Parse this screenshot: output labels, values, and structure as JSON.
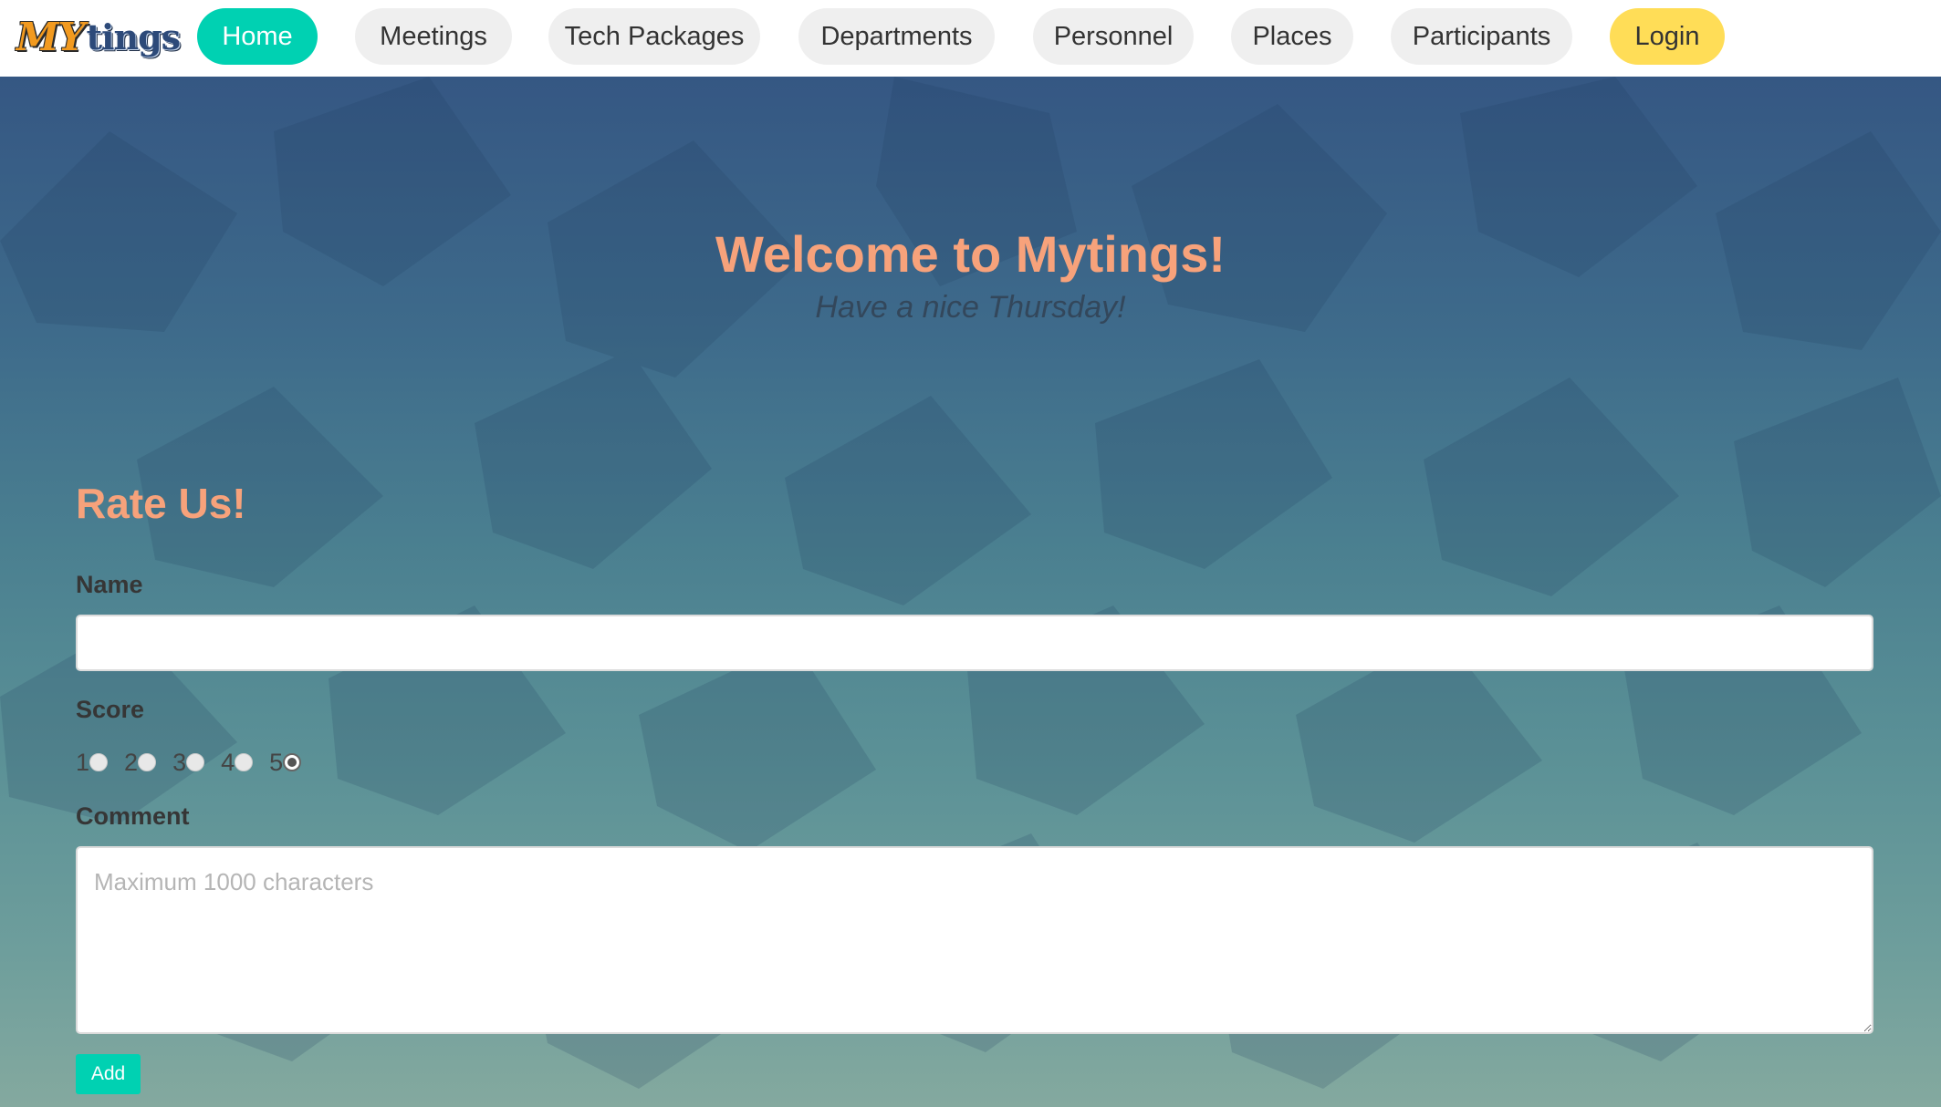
{
  "brand": {
    "logo_part1": "MY",
    "logo_part2": "tings"
  },
  "nav": {
    "items": [
      {
        "label": "Home",
        "active": true
      },
      {
        "label": "Meetings"
      },
      {
        "label": "Tech Packages"
      },
      {
        "label": "Departments"
      },
      {
        "label": "Personnel"
      },
      {
        "label": "Places"
      },
      {
        "label": "Participants"
      }
    ],
    "login_label": "Login"
  },
  "hero": {
    "title": "Welcome to Mytings!",
    "subtitle": "Have a nice Thursday!"
  },
  "form": {
    "title": "Rate Us!",
    "name_label": "Name",
    "name_value": "",
    "score_label": "Score",
    "score_options": [
      "1",
      "2",
      "3",
      "4",
      "5"
    ],
    "score_selected": "5",
    "comment_label": "Comment",
    "comment_placeholder": "Maximum 1000 characters",
    "comment_value": "",
    "add_label": "Add"
  },
  "colors": {
    "accent": "#00d1b2",
    "login": "#ffdd57",
    "heading": "#f7a27b"
  }
}
